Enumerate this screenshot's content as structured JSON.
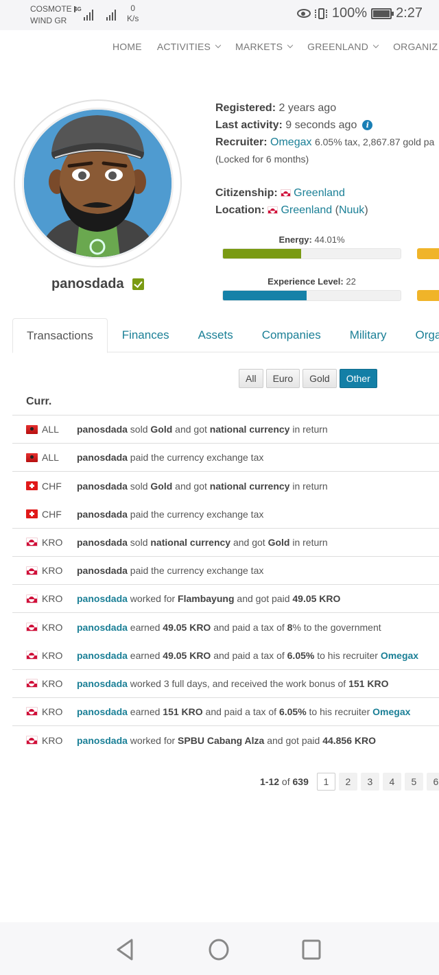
{
  "status_bar": {
    "carrier1": "COSMOTE",
    "carrier2": "WIND GR",
    "network_type": "4G",
    "speed_value": "0",
    "speed_unit": "K/s",
    "battery": "100%",
    "time": "2:27"
  },
  "nav": {
    "items": [
      {
        "label": "HOME",
        "dropdown": false
      },
      {
        "label": "ACTIVITIES",
        "dropdown": true
      },
      {
        "label": "MARKETS",
        "dropdown": true
      },
      {
        "label": "GREENLAND",
        "dropdown": true
      },
      {
        "label": "ORGANIZ",
        "dropdown": false
      }
    ]
  },
  "profile": {
    "username": "panosdada",
    "verified": true,
    "registered_label": "Registered:",
    "registered_value": "2 years ago",
    "last_activity_label": "Last activity:",
    "last_activity_value": "9 seconds ago",
    "recruiter_label": "Recruiter:",
    "recruiter_name": "Omegax",
    "recruiter_details": "6.05% tax, 2,867.87 gold pa",
    "recruiter_lock": "(Locked for 6 months)",
    "citizenship_label": "Citizenship:",
    "citizenship_value": "Greenland",
    "location_label": "Location:",
    "location_country": "Greenland",
    "location_city": "Nuuk",
    "energy_label": "Energy:",
    "energy_value": "44.01%",
    "energy_fraction": 0.4401,
    "experience_label": "Experience Level:",
    "experience_value": "22",
    "experience_fraction": 0.47
  },
  "colors": {
    "link": "#1a7f96",
    "energy_bar": "#7a9a13",
    "experience_bar": "#1581a8",
    "side_bar": "#f0b429",
    "active_filter": "#137fa6"
  },
  "tabs": [
    {
      "label": "Transactions",
      "active": true
    },
    {
      "label": "Finances",
      "active": false
    },
    {
      "label": "Assets",
      "active": false
    },
    {
      "label": "Companies",
      "active": false
    },
    {
      "label": "Military",
      "active": false
    },
    {
      "label": "Orga",
      "active": false
    }
  ],
  "filters": [
    {
      "label": "All",
      "active": false
    },
    {
      "label": "Euro",
      "active": false
    },
    {
      "label": "Gold",
      "active": false
    },
    {
      "label": "Other",
      "active": true
    }
  ],
  "table": {
    "header_currency": "Curr.",
    "rows": [
      {
        "flag": "al",
        "currency": "ALL",
        "separator": true,
        "user_link": false,
        "parts": [
          [
            "u",
            "panosdada"
          ],
          [
            "t",
            " sold "
          ],
          [
            "b",
            "Gold"
          ],
          [
            "t",
            " and got "
          ],
          [
            "b",
            "national currency"
          ],
          [
            "t",
            " in return"
          ]
        ]
      },
      {
        "flag": "al",
        "currency": "ALL",
        "separator": true,
        "user_link": false,
        "parts": [
          [
            "u",
            "panosdada"
          ],
          [
            "t",
            " paid the currency exchange tax"
          ]
        ]
      },
      {
        "flag": "ch",
        "currency": "CHF",
        "separator": false,
        "user_link": false,
        "parts": [
          [
            "u",
            "panosdada"
          ],
          [
            "t",
            " sold "
          ],
          [
            "b",
            "Gold"
          ],
          [
            "t",
            " and got "
          ],
          [
            "b",
            "national currency"
          ],
          [
            "t",
            " in return"
          ]
        ]
      },
      {
        "flag": "ch",
        "currency": "CHF",
        "separator": true,
        "user_link": false,
        "parts": [
          [
            "u",
            "panosdada"
          ],
          [
            "t",
            " paid the currency exchange tax"
          ]
        ]
      },
      {
        "flag": "gl",
        "currency": "KRO",
        "separator": true,
        "user_link": false,
        "parts": [
          [
            "u",
            "panosdada"
          ],
          [
            "t",
            " sold "
          ],
          [
            "b",
            "national currency"
          ],
          [
            "t",
            " and got "
          ],
          [
            "b",
            "Gold"
          ],
          [
            "t",
            " in return"
          ]
        ]
      },
      {
        "flag": "gl",
        "currency": "KRO",
        "separator": true,
        "user_link": false,
        "parts": [
          [
            "u",
            "panosdada"
          ],
          [
            "t",
            " paid the currency exchange tax"
          ]
        ]
      },
      {
        "flag": "gl",
        "currency": "KRO",
        "separator": true,
        "user_link": true,
        "parts": [
          [
            "u",
            "panosdada"
          ],
          [
            "t",
            " worked for "
          ],
          [
            "b",
            "Flambayung"
          ],
          [
            "t",
            " and got paid "
          ],
          [
            "b",
            "49.05 KRO"
          ]
        ]
      },
      {
        "flag": "gl",
        "currency": "KRO",
        "separator": false,
        "user_link": true,
        "parts": [
          [
            "u",
            "panosdada"
          ],
          [
            "t",
            " earned "
          ],
          [
            "b",
            "49.05 KRO"
          ],
          [
            "t",
            " and paid a tax of "
          ],
          [
            "b",
            "8"
          ],
          [
            "t",
            "% to the government"
          ]
        ]
      },
      {
        "flag": "gl",
        "currency": "KRO",
        "separator": true,
        "user_link": true,
        "parts": [
          [
            "u",
            "panosdada"
          ],
          [
            "t",
            " earned "
          ],
          [
            "b",
            "49.05 KRO"
          ],
          [
            "t",
            " and paid a tax of "
          ],
          [
            "b",
            "6.05%"
          ],
          [
            "t",
            " to his recruiter "
          ],
          [
            "l",
            "Omegax"
          ]
        ]
      },
      {
        "flag": "gl",
        "currency": "KRO",
        "separator": true,
        "user_link": true,
        "parts": [
          [
            "u",
            "panosdada"
          ],
          [
            "t",
            " worked 3 full days, and received the work bonus of "
          ],
          [
            "b",
            "151 KRO"
          ]
        ]
      },
      {
        "flag": "gl",
        "currency": "KRO",
        "separator": true,
        "user_link": true,
        "parts": [
          [
            "u",
            "panosdada"
          ],
          [
            "t",
            " earned "
          ],
          [
            "b",
            "151 KRO"
          ],
          [
            "t",
            " and paid a tax of "
          ],
          [
            "b",
            "6.05%"
          ],
          [
            "t",
            " to his recruiter "
          ],
          [
            "l",
            "Omegax"
          ]
        ]
      },
      {
        "flag": "gl",
        "currency": "KRO",
        "separator": false,
        "user_link": true,
        "parts": [
          [
            "u",
            "panosdada"
          ],
          [
            "t",
            " worked for "
          ],
          [
            "b",
            "SPBU Cabang Alza"
          ],
          [
            "t",
            " and got paid "
          ],
          [
            "b",
            "44.856 KRO"
          ]
        ]
      }
    ]
  },
  "pagination": {
    "range": "1-12",
    "of_label": "of",
    "total": "639",
    "pages": [
      "1",
      "2",
      "3",
      "4",
      "5",
      "6"
    ],
    "current": "1"
  },
  "android_nav": {
    "back": "back-icon",
    "home": "home-icon",
    "recents": "recents-icon"
  }
}
